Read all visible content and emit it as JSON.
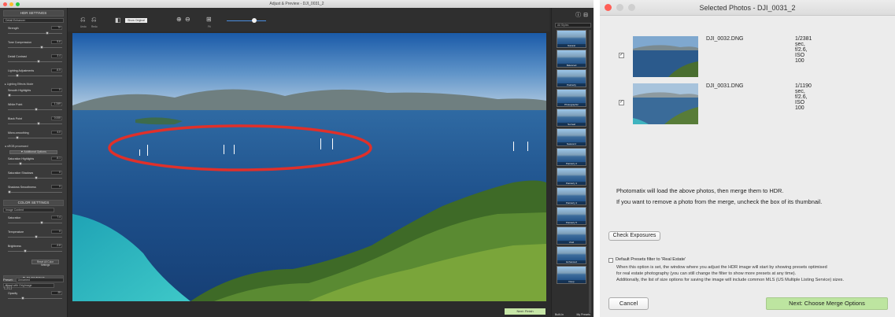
{
  "left_window": {
    "title": "Adjust & Preview - DJI_0031_2",
    "hdr_settings": {
      "header": "HDR SETTINGS",
      "method": "Detail Enhancer",
      "sliders": [
        {
          "label": "Strength",
          "value": "70",
          "level": 0.7
        },
        {
          "label": "Tone Compression",
          "value": "5.6",
          "level": 0.6
        },
        {
          "label": "Detail Contrast",
          "value": "3.4",
          "level": 0.55
        },
        {
          "label": "Lighting Adjustments",
          "value": "-6.5",
          "level": 0.15
        },
        {
          "label": "Smooth Highlights",
          "value": "0",
          "level": 0.0
        },
        {
          "label": "White Point",
          "value": "1.349",
          "level": 0.5
        },
        {
          "label": "Black Point",
          "value": "0.005",
          "level": 0.55
        },
        {
          "label": "Micro-smoothing",
          "value": "4.0",
          "level": 0.15
        }
      ],
      "lighting_effects_label": "▸ Lighting Effects Mode",
      "srgb_label": "sRGB processed",
      "additional_options": "▼ Additional Options",
      "more_sliders": [
        {
          "label": "Saturation Highlights",
          "value": "-5.1",
          "level": 0.2
        },
        {
          "label": "Saturation Shadows",
          "value": "0",
          "level": 0.5
        },
        {
          "label": "Shadows Smoothness",
          "value": "0",
          "level": 0.0
        }
      ]
    },
    "color_settings": {
      "header": "COLOR SETTINGS",
      "mode": "Image Content",
      "sliders": [
        {
          "label": "Saturation",
          "value": "7.4",
          "level": 0.6
        },
        {
          "label": "Temperature",
          "value": "0",
          "level": 0.5
        },
        {
          "label": "Brightness",
          "value": "-3.8",
          "level": 0.3
        }
      ],
      "reset_button": "Reset All Color Settings"
    },
    "blending": {
      "header": "▼ BLENDING",
      "mode": "Blend with OrigImage",
      "opacity_label": "Opacity",
      "opacity_value": "25",
      "opacity_level": 0.25
    },
    "preset_label": "Preset:",
    "preset_value": "Unnamed",
    "toolbar": {
      "undo_label": "Undo",
      "redo_label": "Redo",
      "show_original": "Show Original",
      "zoom_fit_label": "Fit",
      "zoom_level": 0.7
    },
    "styles_dropdown": "All Styles",
    "styles": [
      "Natural",
      "Balanced",
      "Painterly",
      "Photographic",
      "Surreal",
      "Natural 2",
      "Painterly 2",
      "Painterly 3",
      "Painterly 4",
      "Painterly 5",
      "Vivid",
      "Enhanced",
      "Deep"
    ],
    "bottom_tabs": {
      "builtin": "Built-In",
      "my_presets": "My Presets"
    },
    "next_finish": "Next: Finish"
  },
  "right_window": {
    "title": "Selected Photos - DJI_0031_2",
    "photos": [
      {
        "name": "DJI_0032.DNG",
        "exif": "1/2381 sec, f/2.6, ISO 100",
        "checked": true
      },
      {
        "name": "DJI_0031.DNG",
        "exif": "1/1190 sec, f/2.6, ISO 100",
        "checked": true
      }
    ],
    "message_line1": "Photomatix will load the above photos, then merge them to HDR.",
    "message_line2": "If you want to remove a photo from the merge, uncheck the box of its thumbnail.",
    "check_exposures": "Check Exposures",
    "option_label": "Default Presets filter to 'Real Estate'",
    "option_desc1": "When this option is set, the window where you adjust the HDR image will start by showing presets optimised",
    "option_desc2": "for real estate photography (you can still change the filter to show more presets at any time).",
    "option_desc3": "Additionally, the list of size options for saving the image will include common MLS (US Multiple Listing Service) sizes.",
    "cancel": "Cancel",
    "next_merge": "Next: Choose Merge Options"
  },
  "colors": {
    "close": "#ff5f57",
    "minimize": "#febc2e",
    "zoom": "#28c840",
    "highlight_ellipse": "#e0302a",
    "next_button": "#bde5a0"
  }
}
